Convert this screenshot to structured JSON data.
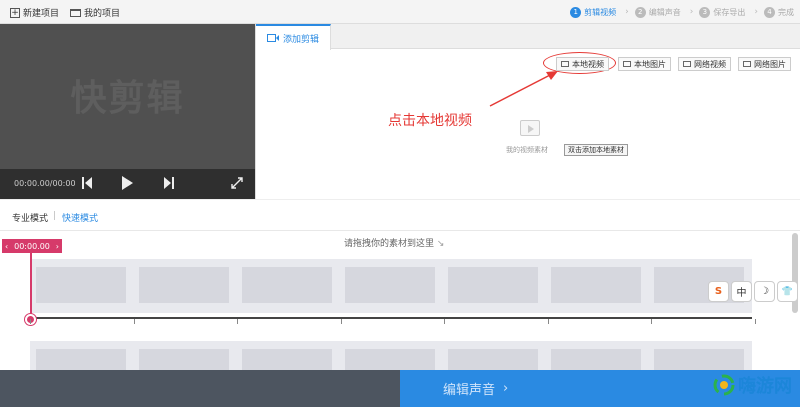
{
  "topbar": {
    "new_project": "新建项目",
    "my_projects": "我的项目",
    "steps": [
      {
        "num": "1",
        "label": "剪辑视频"
      },
      {
        "num": "2",
        "label": "编辑声音"
      },
      {
        "num": "3",
        "label": "保存导出"
      },
      {
        "num": "4",
        "label": "完成"
      }
    ],
    "active_step": 1,
    "accent_color": "#2a8ae2"
  },
  "preview": {
    "watermark": "快剪辑",
    "time": "00:00.00/00:00.0"
  },
  "panel": {
    "tab_label": "添加剪辑",
    "buttons": [
      "本地视频",
      "本地图片",
      "网络视频",
      "网络图片"
    ],
    "annotation": "点击本地视频",
    "material_label": "我的视频素材",
    "tooltip": "双击添加本地素材"
  },
  "modes": {
    "pro": "专业模式",
    "separator": "|",
    "quick": "快速模式"
  },
  "timeline": {
    "hint": "请拖拽你的素材到这里",
    "playhead_time": "00:00.00"
  },
  "ime": {
    "logo": "S",
    "mode": "中",
    "moon": "☽",
    "shirt": "👕"
  },
  "bottom": {
    "next_label": "编辑声音",
    "chevron": "›",
    "site_logo": "嗨游网"
  }
}
